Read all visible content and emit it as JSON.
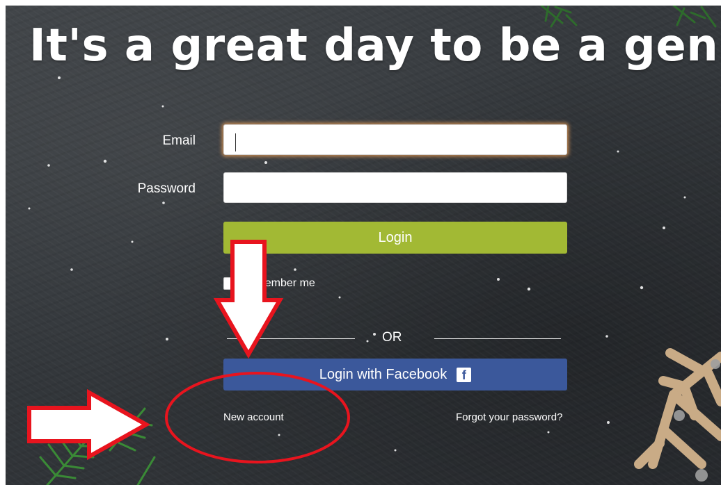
{
  "headline": "It's a great day to be a genius!",
  "form": {
    "email_label": "Email",
    "email_value": "",
    "password_label": "Password",
    "password_value": "",
    "login_label": "Login",
    "remember_label": "Remember me",
    "remember_checked": false,
    "divider_label": "OR",
    "facebook_label": "Login with Facebook",
    "facebook_icon": "facebook-icon",
    "new_account_label": "New account",
    "forgot_password_label": "Forgot your password?"
  },
  "colors": {
    "background": "#33373b",
    "login_button": "#a2b934",
    "facebook_button": "#3b589b",
    "annotation": "#e8141e"
  },
  "annotations": {
    "arrows": [
      "down-arrow",
      "right-arrow"
    ],
    "highlight": "new-account-circle"
  }
}
